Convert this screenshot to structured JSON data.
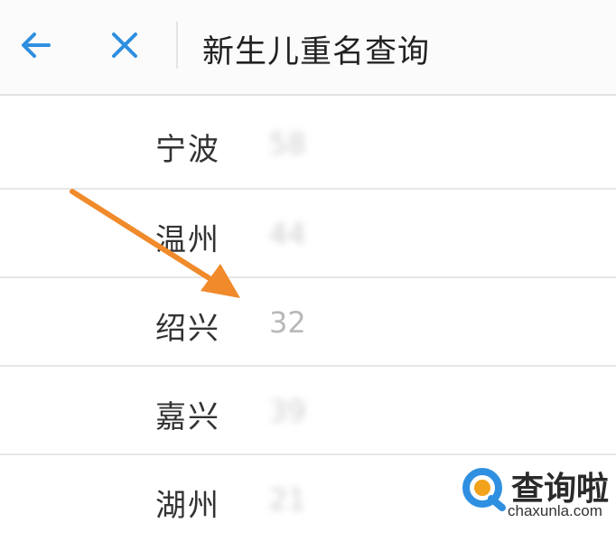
{
  "header": {
    "back_icon": "arrow-left-icon",
    "close_icon": "close-icon",
    "title": "新生儿重名查询"
  },
  "rows": [
    {
      "city": "宁波",
      "value": "58"
    },
    {
      "city": "温州",
      "value": "44"
    },
    {
      "city": "绍兴",
      "value": "32"
    },
    {
      "city": "嘉兴",
      "value": "39"
    },
    {
      "city": "湖州",
      "value": "21"
    }
  ],
  "watermark": {
    "name": "查询啦",
    "url": "chaxunla.com"
  },
  "colors": {
    "accent": "#2f8fe0",
    "arrow": "#f08a2b"
  }
}
